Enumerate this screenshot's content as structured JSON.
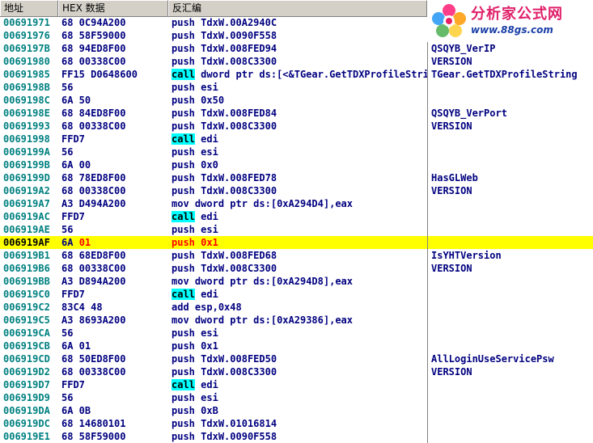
{
  "header": {
    "address": "地址",
    "hex": "HEX 数据",
    "disasm": "反汇编",
    "comment": ""
  },
  "watermark": {
    "title": "分析家公式网",
    "url": "www.88gs.com"
  },
  "rows": [
    {
      "addr": "00691971",
      "hex": "68 0C94A200",
      "mn": "push",
      "op": "TdxW.00A2940C",
      "cm": ""
    },
    {
      "addr": "00691976",
      "hex": "68 58F59000",
      "mn": "push",
      "op": "TdxW.0090F558",
      "cm": ""
    },
    {
      "addr": "0069197B",
      "hex": "68 94ED8F00",
      "mn": "push",
      "op": "TdxW.008FED94",
      "cm": "QSQYB_VerIP"
    },
    {
      "addr": "00691980",
      "hex": "68 00338C00",
      "mn": "push",
      "op": "TdxW.008C3300",
      "cm": "VERSION"
    },
    {
      "addr": "00691985",
      "hex": "FF15 D0648600",
      "mn": "call",
      "op": "dword ptr ds:[<&TGear.GetTDXProfileString>]",
      "cm": "TGear.GetTDXProfileString"
    },
    {
      "addr": "0069198B",
      "hex": "56",
      "mn": "push",
      "op": "esi",
      "cm": ""
    },
    {
      "addr": "0069198C",
      "hex": "6A 50",
      "mn": "push",
      "op": "0x50",
      "cm": ""
    },
    {
      "addr": "0069198E",
      "hex": "68 84ED8F00",
      "mn": "push",
      "op": "TdxW.008FED84",
      "cm": "QSQYB_VerPort"
    },
    {
      "addr": "00691993",
      "hex": "68 00338C00",
      "mn": "push",
      "op": "TdxW.008C3300",
      "cm": "VERSION"
    },
    {
      "addr": "00691998",
      "hex": "FFD7",
      "mn": "call",
      "op": "edi",
      "cm": ""
    },
    {
      "addr": "0069199A",
      "hex": "56",
      "mn": "push",
      "op": "esi",
      "cm": ""
    },
    {
      "addr": "0069199B",
      "hex": "6A 00",
      "mn": "push",
      "op": "0x0",
      "cm": ""
    },
    {
      "addr": "0069199D",
      "hex": "68 78ED8F00",
      "mn": "push",
      "op": "TdxW.008FED78",
      "cm": "HasGLWeb"
    },
    {
      "addr": "006919A2",
      "hex": "68 00338C00",
      "mn": "push",
      "op": "TdxW.008C3300",
      "cm": "VERSION"
    },
    {
      "addr": "006919A7",
      "hex": "A3 D494A200",
      "mn": "mov",
      "op": "dword ptr ds:[0xA294D4],eax",
      "cm": ""
    },
    {
      "addr": "006919AC",
      "hex": "FFD7",
      "mn": "call",
      "op": "edi",
      "cm": ""
    },
    {
      "addr": "006919AE",
      "hex": "56",
      "mn": "push",
      "op": "esi",
      "cm": ""
    },
    {
      "addr": "006919AF",
      "hex": "6A",
      "imm": "01",
      "mn": "push",
      "op": "0x1",
      "cm": "",
      "highlight": true
    },
    {
      "addr": "006919B1",
      "hex": "68 68ED8F00",
      "mn": "push",
      "op": "TdxW.008FED68",
      "cm": "IsYHTVersion"
    },
    {
      "addr": "006919B6",
      "hex": "68 00338C00",
      "mn": "push",
      "op": "TdxW.008C3300",
      "cm": "VERSION"
    },
    {
      "addr": "006919BB",
      "hex": "A3 D894A200",
      "mn": "mov",
      "op": "dword ptr ds:[0xA294D8],eax",
      "cm": ""
    },
    {
      "addr": "006919C0",
      "hex": "FFD7",
      "mn": "call",
      "op": "edi",
      "cm": ""
    },
    {
      "addr": "006919C2",
      "hex": "83C4 48",
      "mn": "add",
      "op": "esp,0x48",
      "cm": ""
    },
    {
      "addr": "006919C5",
      "hex": "A3 8693A200",
      "mn": "mov",
      "op": "dword ptr ds:[0xA29386],eax",
      "cm": ""
    },
    {
      "addr": "006919CA",
      "hex": "56",
      "mn": "push",
      "op": "esi",
      "cm": ""
    },
    {
      "addr": "006919CB",
      "hex": "6A 01",
      "mn": "push",
      "op": "0x1",
      "cm": ""
    },
    {
      "addr": "006919CD",
      "hex": "68 50ED8F00",
      "mn": "push",
      "op": "TdxW.008FED50",
      "cm": "AllLoginUseServicePsw"
    },
    {
      "addr": "006919D2",
      "hex": "68 00338C00",
      "mn": "push",
      "op": "TdxW.008C3300",
      "cm": "VERSION"
    },
    {
      "addr": "006919D7",
      "hex": "FFD7",
      "mn": "call",
      "op": "edi",
      "cm": ""
    },
    {
      "addr": "006919D9",
      "hex": "56",
      "mn": "push",
      "op": "esi",
      "cm": ""
    },
    {
      "addr": "006919DA",
      "hex": "6A 0B",
      "mn": "push",
      "op": "0xB",
      "cm": ""
    },
    {
      "addr": "006919DC",
      "hex": "68 14680101",
      "mn": "push",
      "op": "TdxW.01016814",
      "cm": ""
    },
    {
      "addr": "006919E1",
      "hex": "68 58F59000",
      "mn": "push",
      "op": "TdxW.0090F558",
      "cm": ""
    }
  ],
  "colors": {
    "highlight": "#ffff00",
    "call": "#00ffff",
    "address": "#008080",
    "code": "#000080"
  },
  "icons": {
    "logo": "flower-logo-icon"
  }
}
